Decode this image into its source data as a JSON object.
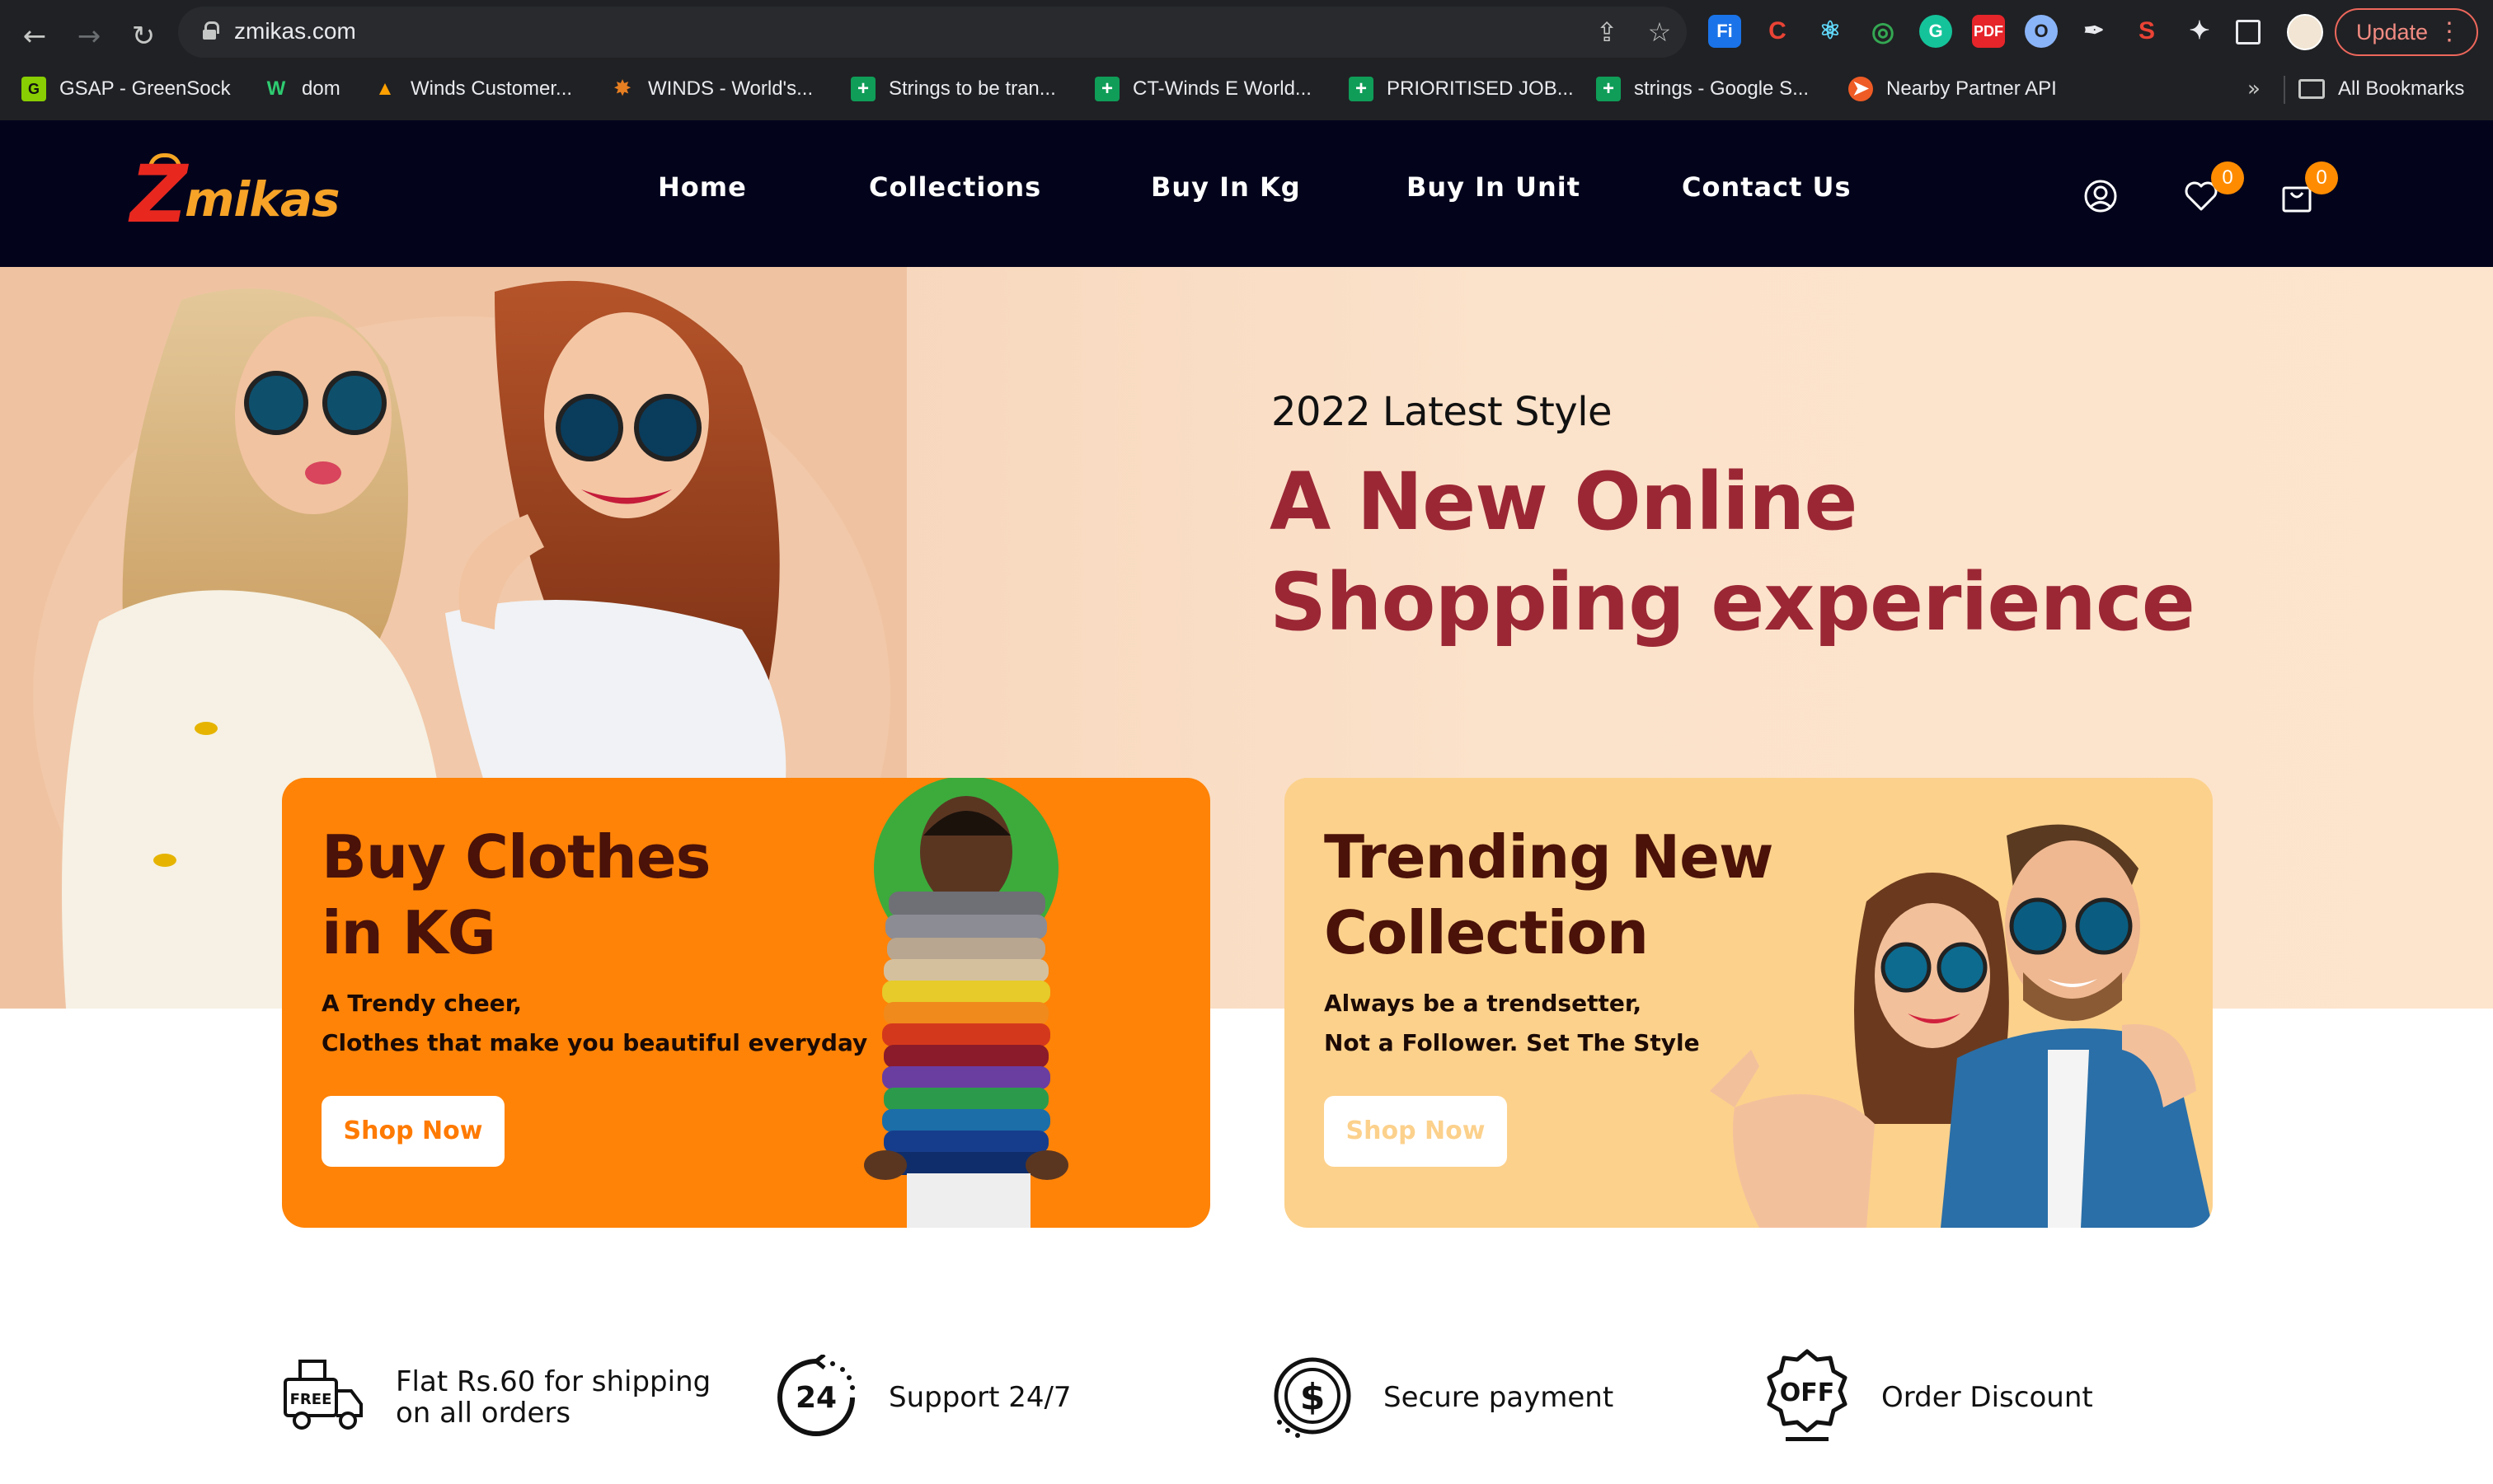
{
  "browser": {
    "url": "zmikas.com",
    "update_label": "Update",
    "bookmarks": [
      {
        "label": "GSAP - GreenSock",
        "icon": "greensock-icon"
      },
      {
        "label": "dom",
        "icon": "w-logo-icon"
      },
      {
        "label": "Winds Customer...",
        "icon": "flame-icon"
      },
      {
        "label": "WINDS - World's...",
        "icon": "winds-icon"
      },
      {
        "label": "Strings to be tran...",
        "icon": "google-sheets-icon"
      },
      {
        "label": "CT-Winds E World...",
        "icon": "google-sheets-icon"
      },
      {
        "label": "PRIORITISED JOB...",
        "icon": "google-sheets-icon"
      },
      {
        "label": "strings - Google S...",
        "icon": "google-sheets-icon"
      },
      {
        "label": "Nearby Partner API",
        "icon": "postman-icon"
      }
    ],
    "more_label": "»",
    "all_bookmarks_label": "All Bookmarks",
    "extensions": [
      "Fi",
      "C",
      "react",
      "target",
      "G",
      "pdf",
      "circle",
      "picker",
      "S",
      "puzzle",
      "sidepanel"
    ]
  },
  "site": {
    "logo_initial": "Z",
    "logo_text": "mikas",
    "nav": [
      "Home",
      "Collections",
      "Buy In Kg",
      "Buy In Unit",
      "Contact Us"
    ],
    "wishlist_count": "0",
    "cart_count": "0"
  },
  "hero": {
    "subtitle": "2022 Latest Style",
    "title": "A New Online Shopping experience"
  },
  "cards": [
    {
      "title_line1": "Buy Clothes",
      "title_line2": "in KG",
      "text_line1": "A Trendy cheer,",
      "text_line2": "Clothes that make you beautiful everyday",
      "button": "Shop Now"
    },
    {
      "title_line1": "Trending New",
      "title_line2": "Collection",
      "text_line1": "Always be a trendsetter,",
      "text_line2": "Not a Follower. Set The Style",
      "button": "Shop Now"
    }
  ],
  "features": [
    {
      "line1": "Flat Rs.60 for shipping",
      "line2": "on all orders",
      "icon": "free-delivery-truck-icon",
      "icon_text": "FREE"
    },
    {
      "line1": "Support 24/7",
      "line2": "",
      "icon": "support-24-icon",
      "icon_text": "24"
    },
    {
      "line1": "Secure payment",
      "line2": "",
      "icon": "secure-payment-dollar-icon",
      "icon_text": "$"
    },
    {
      "line1": "Order Discount",
      "line2": "",
      "icon": "discount-off-badge-icon",
      "icon_text": "OFF"
    }
  ],
  "colors": {
    "header_bg": "#03041c",
    "logo_orange": "#f6a327",
    "logo_red": "#e8281f",
    "hero_title": "#9b2735",
    "card_orange": "#ff8307",
    "card_peach": "#fcd18c",
    "badge": "#ff8c00"
  }
}
